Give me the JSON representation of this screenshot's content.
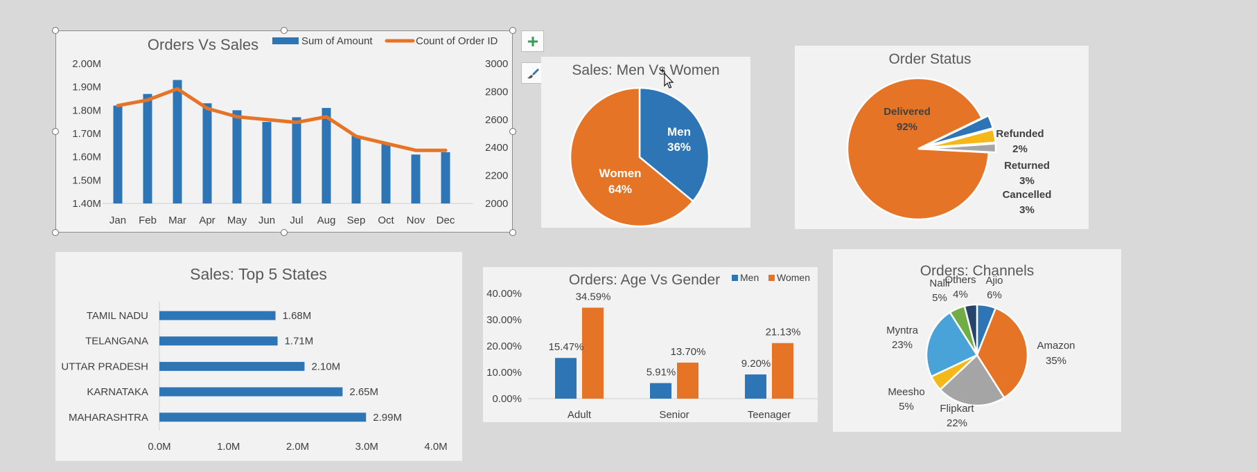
{
  "colors": {
    "blue": "#2e75b6",
    "orange": "#e67426",
    "gray": "#a5a5a5",
    "yellow": "#f5b819",
    "lightblue": "#4aa3d8",
    "green": "#70ad47",
    "navy": "#26446b"
  },
  "icons": {
    "add": "plus-icon",
    "style": "paintbrush-icon",
    "cursor": "move-cursor-icon"
  },
  "chart_data": [
    {
      "id": "orders_vs_sales",
      "type": "bar",
      "title": "Orders Vs Sales",
      "categories": [
        "Jan",
        "Feb",
        "Mar",
        "Apr",
        "May",
        "Jun",
        "Jul",
        "Aug",
        "Sep",
        "Oct",
        "Nov",
        "Dec"
      ],
      "series": [
        {
          "name": "Sum of Amount",
          "kind": "bar",
          "axis": "left",
          "values": [
            1.82,
            1.87,
            1.93,
            1.83,
            1.8,
            1.75,
            1.77,
            1.81,
            1.69,
            1.66,
            1.61,
            1.62
          ]
        },
        {
          "name": "Count of Order ID",
          "kind": "line",
          "axis": "right",
          "values": [
            2700,
            2740,
            2820,
            2680,
            2620,
            2600,
            2580,
            2620,
            2480,
            2430,
            2380,
            2380
          ]
        }
      ],
      "left_ticks": [
        "2.00M",
        "1.90M",
        "1.80M",
        "1.70M",
        "1.60M",
        "1.50M",
        "1.40M"
      ],
      "right_ticks": [
        "3000",
        "2800",
        "2600",
        "2400",
        "2200",
        "2000"
      ],
      "ylim_left": [
        1.4,
        2.0
      ],
      "ylim_right": [
        2000,
        3000
      ],
      "legend": "top",
      "grid": false
    },
    {
      "id": "men_vs_women",
      "type": "pie",
      "title": "Sales: Men Vs Women",
      "slices": [
        {
          "label": "Men",
          "pct": "36%",
          "value": 36
        },
        {
          "label": "Women",
          "pct": "64%",
          "value": 64
        }
      ]
    },
    {
      "id": "order_status",
      "type": "pie",
      "title": "Order Status",
      "slices": [
        {
          "label": "Delivered",
          "pct": "92%",
          "value": 92
        },
        {
          "label": "Cancelled",
          "pct": "3%",
          "value": 3
        },
        {
          "label": "Returned",
          "pct": "3%",
          "value": 3
        },
        {
          "label": "Refunded",
          "pct": "2%",
          "value": 2
        }
      ]
    },
    {
      "id": "top_states",
      "type": "bar",
      "orientation": "horizontal",
      "title": "Sales: Top 5 States",
      "categories": [
        "TAMIL NADU",
        "TELANGANA",
        "UTTAR PRADESH",
        "KARNATAKA",
        "MAHARASHTRA"
      ],
      "values": [
        1.68,
        1.71,
        2.1,
        2.65,
        2.99
      ],
      "value_labels": [
        "1.68M",
        "1.71M",
        "2.10M",
        "2.65M",
        "2.99M"
      ],
      "x_ticks": [
        "0.0M",
        "1.0M",
        "2.0M",
        "3.0M",
        "4.0M"
      ],
      "xlim": [
        0,
        4
      ]
    },
    {
      "id": "age_vs_gender",
      "type": "bar",
      "title": "Orders: Age Vs Gender",
      "categories": [
        "Adult",
        "Senior",
        "Teenager"
      ],
      "series": [
        {
          "name": "Men",
          "values": [
            15.47,
            5.91,
            9.2
          ],
          "labels": [
            "15.47%",
            "5.91%",
            "9.20%"
          ]
        },
        {
          "name": "Women",
          "values": [
            34.59,
            13.7,
            21.13
          ],
          "labels": [
            "34.59%",
            "13.70%",
            "21.13%"
          ]
        }
      ],
      "y_ticks": [
        "40.00%",
        "30.00%",
        "20.00%",
        "10.00%",
        "0.00%"
      ],
      "ylim": [
        0,
        40
      ],
      "legend": "top-right"
    },
    {
      "id": "channels",
      "type": "pie",
      "title": "Orders: Channels",
      "slices": [
        {
          "label": "Ajio",
          "pct": "6%",
          "value": 6
        },
        {
          "label": "Amazon",
          "pct": "35%",
          "value": 35
        },
        {
          "label": "Flipkart",
          "pct": "22%",
          "value": 22
        },
        {
          "label": "Meesho",
          "pct": "5%",
          "value": 5
        },
        {
          "label": "Myntra",
          "pct": "23%",
          "value": 23
        },
        {
          "label": "Nalli",
          "pct": "5%",
          "value": 5
        },
        {
          "label": "Others",
          "pct": "4%",
          "value": 4
        }
      ]
    }
  ]
}
